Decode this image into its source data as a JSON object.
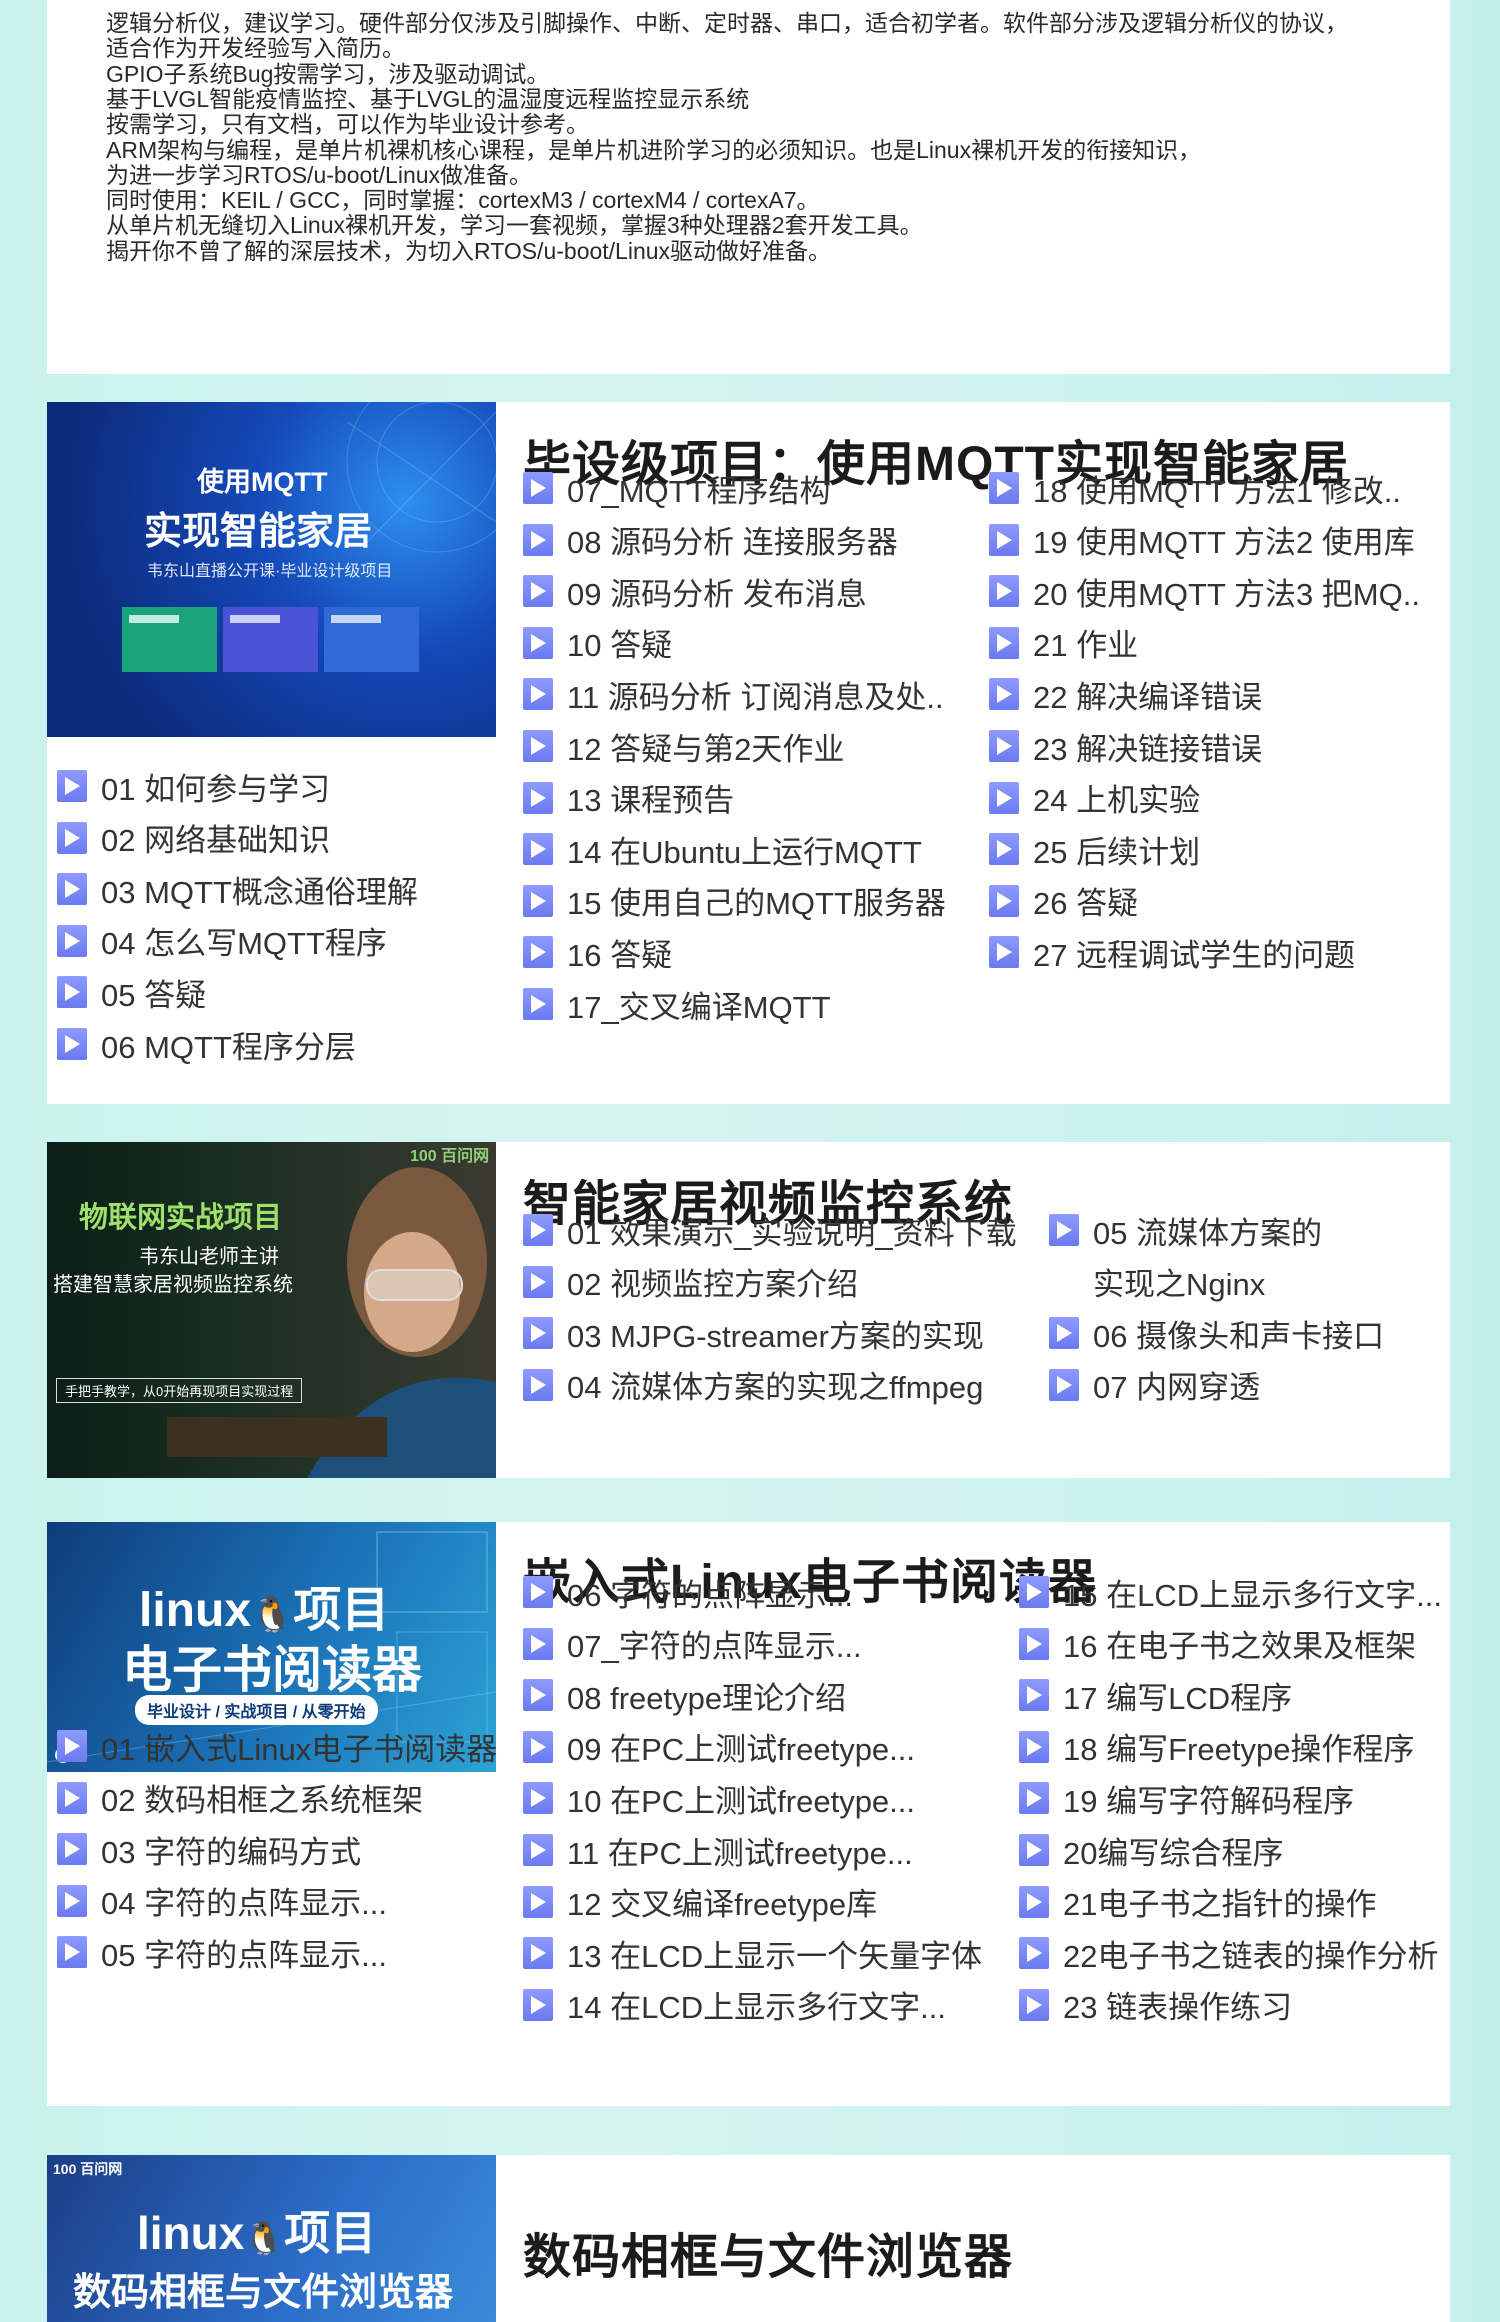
{
  "intro_lines": [
    "逻辑分析仪，建议学习。硬件部分仅涉及引脚操作、中断、定时器、串口，适合初学者。软件部分涉及逻辑分析仪的协议，",
    "适合作为开发经验写入简历。",
    "GPIO子系统Bug按需学习，涉及驱动调试。",
    "基于LVGL智能疫情监控、基于LVGL的温湿度远程监控显示系统",
    "按需学习，只有文档，可以作为毕业设计参考。",
    "ARM架构与编程，是单片机裸机核心课程，是单片机进阶学习的必须知识。也是Linux裸机开发的衔接知识，",
    "为进一步学习RTOS/u-boot/Linux做准备。",
    "同时使用：KEIL / GCC，同时掌握：cortexM3 / cortexM4 / cortexA7。",
    "从单片机无缝切入Linux裸机开发，学习一套视频，掌握3种处理器2套开发工具。",
    "揭开你不曾了解的深层技术，为切入RTOS/u-boot/Linux驱动做好准备。"
  ],
  "courses": [
    {
      "title": "毕设级项目：使用MQTT实现智能家居",
      "thumb": {
        "line1": "使用MQTT",
        "line2": "实现智能家居",
        "line3": "韦东山直播公开课·毕业设计级项目"
      },
      "col1": [
        "01 如何参与学习",
        "02 网络基础知识",
        "03 MQTT概念通俗理解",
        "04 怎么写MQTT程序",
        "05 答疑",
        "06 MQTT程序分层"
      ],
      "col2": [
        "07_MQTT程序结构",
        "08 源码分析 连接服务器",
        "09 源码分析 发布消息",
        "10 答疑",
        "11 源码分析 订阅消息及处..",
        "12 答疑与第2天作业",
        "13 课程预告",
        "14 在Ubuntu上运行MQTT",
        "15 使用自己的MQTT服务器",
        "16 答疑",
        "17_交叉编译MQTT"
      ],
      "col3": [
        "18 使用MQTT 方法1 修改..",
        "19 使用MQTT 方法2 使用库",
        "20 使用MQTT 方法3 把MQ..",
        "21 作业",
        "22 解决编译错误",
        "23 解决链接错误",
        "24 上机实验",
        "25 后续计划",
        "26 答疑",
        "27 远程调试学生的问题"
      ]
    },
    {
      "title": "智能家居视频监控系统",
      "thumb": {
        "line1": "物联网实战项目",
        "line2": "韦东山老师主讲",
        "line3": "搭建智慧家居视频监控系统",
        "line4": "手把手教学，从0开始再现项目实现过程",
        "logo": "100 百问网"
      },
      "col2": [
        "01 效果演示_实验说明_资料下载",
        "02 视频监控方案介绍",
        "03 MJPG-streamer方案的实现",
        "04 流媒体方案的实现之ffmpeg"
      ],
      "col3": [
        "05 流媒体方案的",
        "实现之Nginx",
        "06 摄像头和声卡接口",
        "07 内网穿透"
      ]
    },
    {
      "title": "嵌入式Linux电子书阅读器",
      "thumb": {
        "line1": "linux",
        "line1b": "项目",
        "line2": "电子书阅读器",
        "line3": "毕业设计 / 实战项目 / 从零开始"
      },
      "col1": [
        "01 嵌入式Linux电子书阅读器",
        "02 数码相框之系统框架",
        "03 字符的编码方式",
        "04 字符的点阵显示...",
        "05 字符的点阵显示..."
      ],
      "col2": [
        "06 字符的点阵显示...",
        "07_字符的点阵显示...",
        "08 freetype理论介绍",
        "09 在PC上测试freetype...",
        "10 在PC上测试freetype...",
        "11 在PC上测试freetype...",
        "12 交叉编译freetype库",
        "13 在LCD上显示一个矢量字体",
        "14 在LCD上显示多行文字..."
      ],
      "col3": [
        "15 在LCD上显示多行文字...",
        "16 在电子书之效果及框架",
        "17 编写LCD程序",
        "18 编写Freetype操作程序",
        "19 编写字符解码程序",
        "20编写综合程序",
        "21电子书之指针的操作",
        "22电子书之链表的操作分析",
        "23 链表操作练习"
      ]
    },
    {
      "title": "数码相框与文件浏览器",
      "thumb": {
        "logo": "100 百问网",
        "line1": "linux",
        "line1b": "项目",
        "line2": "数码相框与文件浏览器"
      }
    }
  ]
}
